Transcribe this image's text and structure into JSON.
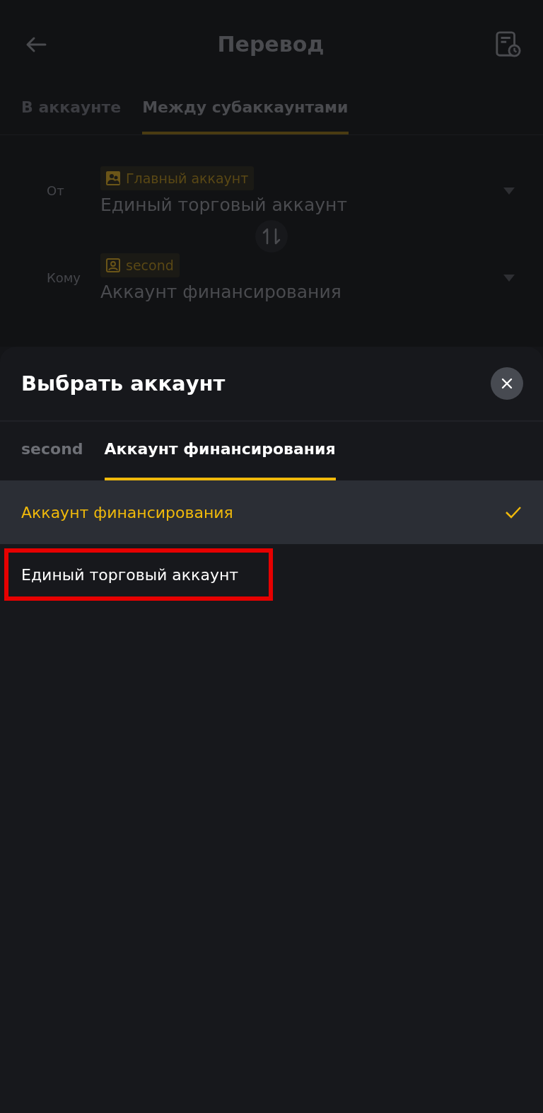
{
  "header": {
    "title": "Перевод"
  },
  "tabs": [
    {
      "label": "В аккаунте",
      "selected": false
    },
    {
      "label": "Между субаккаунтами",
      "selected": true
    }
  ],
  "transfer": [
    {
      "label": "От",
      "tag": {
        "kind": "main",
        "text": "Главный аккаунт"
      },
      "account": "Единый торговый аккаунт"
    },
    {
      "label": "Кому",
      "tag": {
        "kind": "sub",
        "text": "second"
      },
      "account": "Аккаунт финансирования"
    }
  ],
  "sheet": {
    "title": "Выбрать аккаунт",
    "tabs": [
      {
        "label": "second",
        "selected": false
      },
      {
        "label": "Аккаунт финансирования",
        "selected": true
      }
    ],
    "options": [
      {
        "label": "Аккаунт финансирования",
        "selected": true,
        "highlighted": false
      },
      {
        "label": "Единый торговый аккаунт",
        "selected": false,
        "highlighted": true
      }
    ]
  }
}
